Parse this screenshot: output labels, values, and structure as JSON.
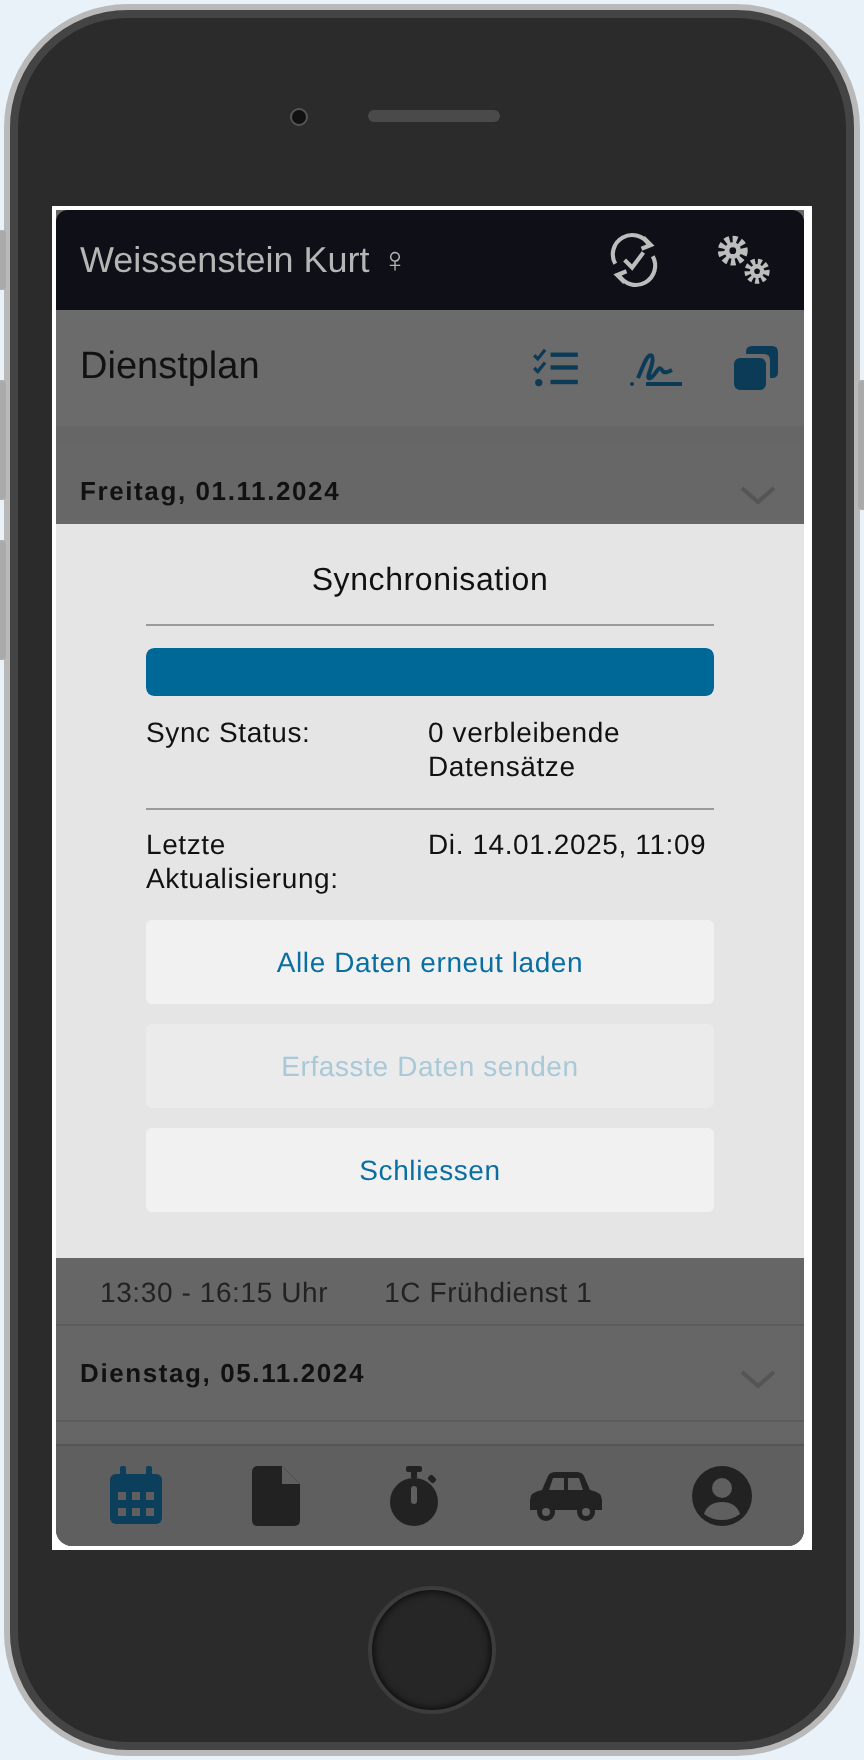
{
  "header": {
    "user_name": "Weissenstein Kurt",
    "gender_symbol": "♀"
  },
  "subheader": {
    "title": "Dienstplan"
  },
  "days": [
    {
      "date": "Freitag, 01.11.2024"
    },
    {
      "date": "Dienstag, 05.11.2024"
    }
  ],
  "shift": {
    "time": "13:30 - 16:15 Uhr",
    "name": "1C Frühdienst 1"
  },
  "dialog": {
    "title": "Synchronisation",
    "progress": {
      "level": 1
    },
    "rows": [
      {
        "label": "Sync Status:",
        "value": "0 verbleibende Datensätze"
      },
      {
        "label": "Letzte Aktualisierung:",
        "value": "Di. 14.01.2025, 11:09"
      }
    ],
    "buttons": [
      {
        "label": "Alle Daten erneut laden",
        "disabled": false
      },
      {
        "label": "Erfasste Daten senden",
        "disabled": true
      },
      {
        "label": "Schliessen",
        "disabled": false
      }
    ]
  },
  "nav": [
    {
      "kind": "calendar",
      "selected": true
    },
    {
      "kind": "document",
      "selected": false
    },
    {
      "kind": "stopwatch",
      "selected": false
    },
    {
      "kind": "car",
      "selected": false
    },
    {
      "kind": "account",
      "selected": false
    }
  ]
}
